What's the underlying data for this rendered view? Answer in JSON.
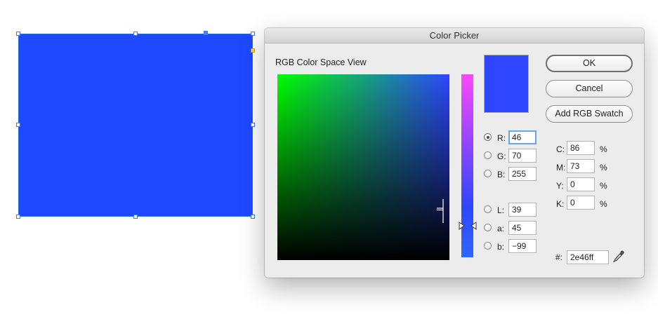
{
  "dialog": {
    "title": "Color Picker",
    "color_space_label": "RGB Color Space View",
    "selected_color": "#2e46ff",
    "buttons": {
      "ok": "OK",
      "cancel": "Cancel",
      "add_swatch": "Add RGB Swatch"
    },
    "rgb": [
      {
        "key": "R:",
        "value": "46",
        "selected": true
      },
      {
        "key": "G:",
        "value": "70",
        "selected": false
      },
      {
        "key": "B:",
        "value": "255",
        "selected": false
      }
    ],
    "lab": [
      {
        "key": "L:",
        "value": "39",
        "selected": false
      },
      {
        "key": "a:",
        "value": "45",
        "selected": false
      },
      {
        "key": "b:",
        "value": "−99",
        "selected": false
      }
    ],
    "cmyk": [
      {
        "key": "C:",
        "value": "86",
        "unit": "%"
      },
      {
        "key": "M:",
        "value": "73",
        "unit": "%"
      },
      {
        "key": "Y:",
        "value": "0",
        "unit": "%"
      },
      {
        "key": "K:",
        "value": "0",
        "unit": "%"
      }
    ],
    "hex": {
      "key": "#:",
      "value": "2e46ff"
    },
    "eyedropper_icon": "eyedropper-icon"
  },
  "canvas": {
    "shape_fill": "#1f49ff"
  }
}
